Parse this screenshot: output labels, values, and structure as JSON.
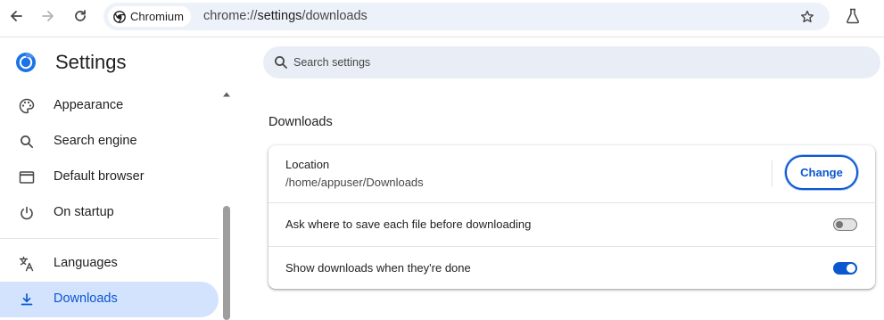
{
  "browser": {
    "chip_label": "Chromium",
    "url_scheme": "chrome://",
    "url_host": "settings",
    "url_path": "/downloads"
  },
  "settings": {
    "title": "Settings",
    "search_placeholder": "Search settings"
  },
  "sidebar": {
    "items": [
      {
        "label": "Appearance",
        "icon": "palette-icon"
      },
      {
        "label": "Search engine",
        "icon": "search-icon"
      },
      {
        "label": "Default browser",
        "icon": "browser-window-icon"
      },
      {
        "label": "On startup",
        "icon": "power-icon"
      },
      {
        "label": "Languages",
        "icon": "translate-icon"
      },
      {
        "label": "Downloads",
        "icon": "download-icon",
        "active": true
      }
    ]
  },
  "downloads": {
    "section_title": "Downloads",
    "location_label": "Location",
    "location_path": "/home/appuser/Downloads",
    "change_label": "Change",
    "ask_where_label": "Ask where to save each file before downloading",
    "ask_where_enabled": false,
    "show_when_done_label": "Show downloads when they're done",
    "show_when_done_enabled": true
  },
  "colors": {
    "accent": "#0b57d0",
    "active_nav_bg": "#d3e3fd",
    "omnibox_bg": "#edf2fa"
  }
}
